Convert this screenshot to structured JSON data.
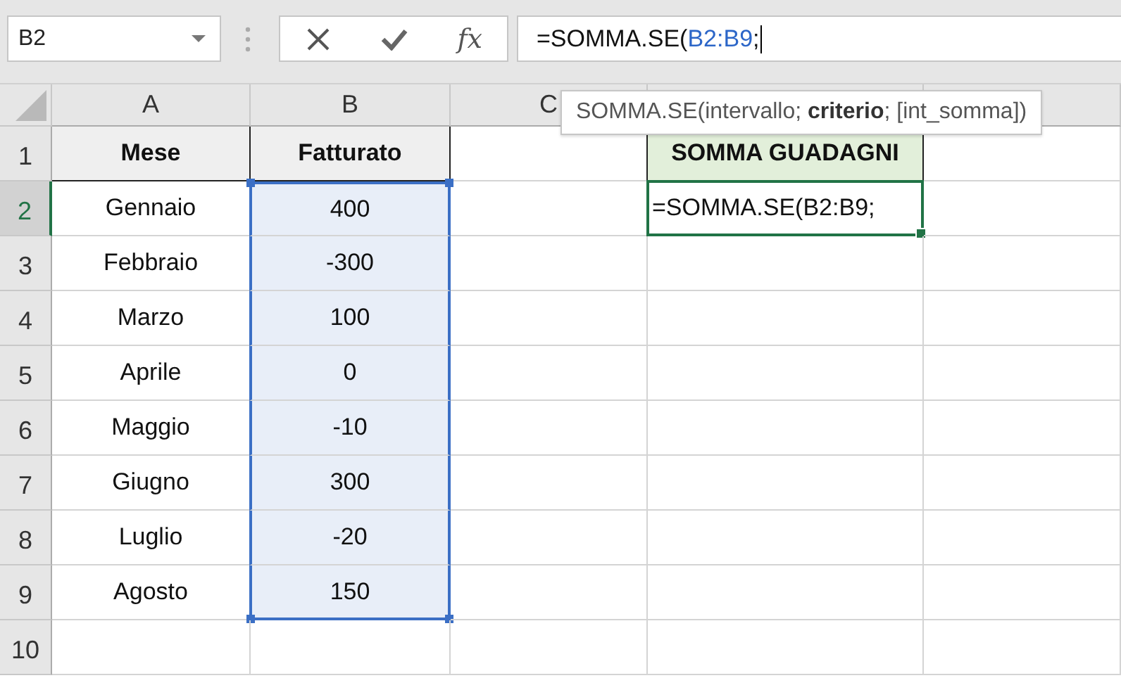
{
  "name_box": {
    "value": "B2"
  },
  "function_button": "fx",
  "formula_bar": {
    "parts": [
      {
        "text": "=SOMMA.SE(",
        "kind": "plain"
      },
      {
        "text": "B2:B9",
        "kind": "reference"
      },
      {
        "text": ";",
        "kind": "plain"
      }
    ]
  },
  "tooltip": "SOMMA.SE(intervallo; **criterio**; [int_somma])",
  "column_headers": [
    {
      "label": "A"
    },
    {
      "label": "B"
    },
    {
      "label": "C"
    }
  ],
  "rows": [
    {
      "number": "1",
      "kind": "header",
      "selected": false,
      "in_range": false,
      "a": "Mese",
      "b": "Fatturato",
      "d": "SOMMA GUADAGNI"
    },
    {
      "number": "2",
      "kind": "data",
      "selected": true,
      "in_range": true,
      "a": "Gennaio",
      "b": "400",
      "d": "=SOMMA.SE(B2:B9;"
    },
    {
      "number": "3",
      "kind": "data",
      "selected": false,
      "in_range": true,
      "a": "Febbraio",
      "b": "-300"
    },
    {
      "number": "4",
      "kind": "data",
      "selected": false,
      "in_range": true,
      "a": "Marzo",
      "b": "100"
    },
    {
      "number": "5",
      "kind": "data",
      "selected": false,
      "in_range": true,
      "a": "Aprile",
      "b": "0"
    },
    {
      "number": "6",
      "kind": "data",
      "selected": false,
      "in_range": true,
      "a": "Maggio",
      "b": "-10"
    },
    {
      "number": "7",
      "kind": "data",
      "selected": false,
      "in_range": true,
      "a": "Giugno",
      "b": "300"
    },
    {
      "number": "8",
      "kind": "data",
      "selected": false,
      "in_range": true,
      "a": "Luglio",
      "b": "-20"
    },
    {
      "number": "9",
      "kind": "data",
      "selected": false,
      "in_range": true,
      "a": "Agosto",
      "b": "150"
    },
    {
      "number": "10",
      "kind": "empty",
      "selected": false,
      "in_range": false
    }
  ]
}
